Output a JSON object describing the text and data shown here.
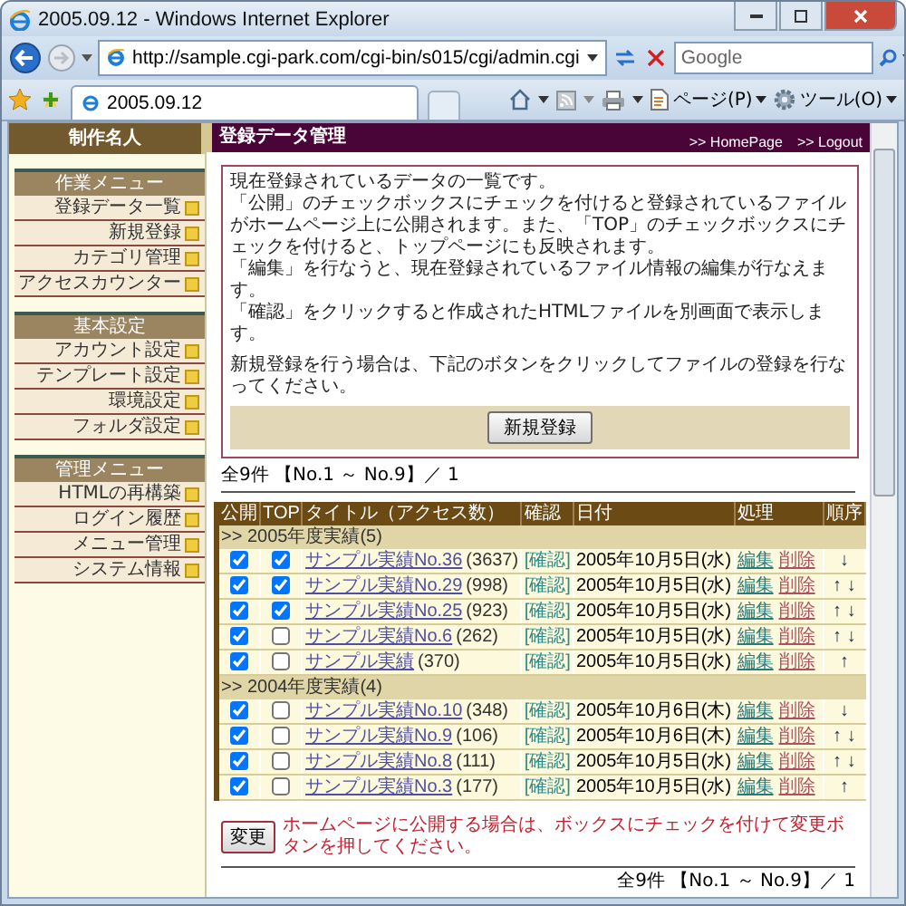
{
  "window": {
    "title": "2005.09.12 - Windows Internet Explorer"
  },
  "address_bar": {
    "url": "http://sample.cgi-park.com/cgi-bin/s015/cgi/admin.cgi"
  },
  "search": {
    "placeholder": "Google"
  },
  "tab": {
    "label": "2005.09.12"
  },
  "toolbar": {
    "menus": [
      "ページ(P)",
      "ツール(O)"
    ]
  },
  "sidebar": {
    "site_name": "制作名人",
    "sections": [
      {
        "title": "作業メニュー",
        "items": [
          "登録データ一覧",
          "新規登録",
          "カテゴリ管理",
          "アクセスカウンター"
        ]
      },
      {
        "title": "基本設定",
        "items": [
          "アカウント設定",
          "テンプレート設定",
          "環境設定",
          "フォルダ設定"
        ]
      },
      {
        "title": "管理メニュー",
        "items": [
          "HTMLの再構築",
          "ログイン履歴",
          "メニュー管理",
          "システム情報"
        ]
      }
    ]
  },
  "header": {
    "title": "登録データ管理",
    "links": [
      ">> HomePage",
      ">> Logout"
    ]
  },
  "intro": {
    "paragraphs": [
      "現在登録されているデータの一覧です。",
      "「公開」のチェックボックスにチェックを付けると登録されているファイルがホームページ上に公開されます。また、「TOP」のチェックボックスにチェックを付けると、トップページにも反映されます。",
      "「編集」を行なうと、現在登録されているファイル情報の編集が行なえます。",
      "「確認」をクリックすると作成されたHTMLファイルを別画面で表示します。"
    ],
    "note": "新規登録を行う場合は、下記のボタンをクリックしてファイルの登録を行なってください。",
    "button": "新規登録"
  },
  "count_top": "全9件 【No.1 ～ No.9】／ 1",
  "table": {
    "columns": [
      "公開",
      "TOP",
      "タイトル（アクセス数）",
      "確認",
      "日付",
      "処理",
      "順序"
    ],
    "groups": [
      {
        "label": ">> 2005年度実績(5)",
        "rows": [
          {
            "public": true,
            "top": true,
            "title": "サンプル実績No.36",
            "count": "(3637)",
            "confirm": "[確認]",
            "date": "2005年10月5日(水)",
            "edit": "編集",
            "delete": "削除",
            "order": "↓"
          },
          {
            "public": true,
            "top": true,
            "title": "サンプル実績No.29",
            "count": "(998)",
            "confirm": "[確認]",
            "date": "2005年10月5日(水)",
            "edit": "編集",
            "delete": "削除",
            "order": "↑ ↓"
          },
          {
            "public": true,
            "top": true,
            "title": "サンプル実績No.25",
            "count": "(923)",
            "confirm": "[確認]",
            "date": "2005年10月5日(水)",
            "edit": "編集",
            "delete": "削除",
            "order": "↑ ↓"
          },
          {
            "public": true,
            "top": false,
            "title": "サンプル実績No.6",
            "count": "(262)",
            "confirm": "[確認]",
            "date": "2005年10月5日(水)",
            "edit": "編集",
            "delete": "削除",
            "order": "↑ ↓"
          },
          {
            "public": true,
            "top": false,
            "title": "サンプル実績",
            "count": "(370)",
            "confirm": "[確認]",
            "date": "2005年10月5日(水)",
            "edit": "編集",
            "delete": "削除",
            "order": "↑"
          }
        ]
      },
      {
        "label": ">> 2004年度実績(4)",
        "rows": [
          {
            "public": true,
            "top": false,
            "title": "サンプル実績No.10",
            "count": "(348)",
            "confirm": "[確認]",
            "date": "2005年10月6日(木)",
            "edit": "編集",
            "delete": "削除",
            "order": "↓"
          },
          {
            "public": true,
            "top": false,
            "title": "サンプル実績No.9",
            "count": "(106)",
            "confirm": "[確認]",
            "date": "2005年10月6日(木)",
            "edit": "編集",
            "delete": "削除",
            "order": "↑ ↓"
          },
          {
            "public": true,
            "top": false,
            "title": "サンプル実績No.8",
            "count": "(111)",
            "confirm": "[確認]",
            "date": "2005年10月5日(水)",
            "edit": "編集",
            "delete": "削除",
            "order": "↑ ↓"
          },
          {
            "public": true,
            "top": false,
            "title": "サンプル実績No.3",
            "count": "(177)",
            "confirm": "[確認]",
            "date": "2005年10月5日(水)",
            "edit": "編集",
            "delete": "削除",
            "order": "↑"
          }
        ]
      }
    ]
  },
  "footer": {
    "button": "変更",
    "note": "ホームページに公開する場合は、ボックスにチェックを付けて変更ボタンを押してください。",
    "count": "全9件 【No.1 ～ No.9】／ 1"
  }
}
